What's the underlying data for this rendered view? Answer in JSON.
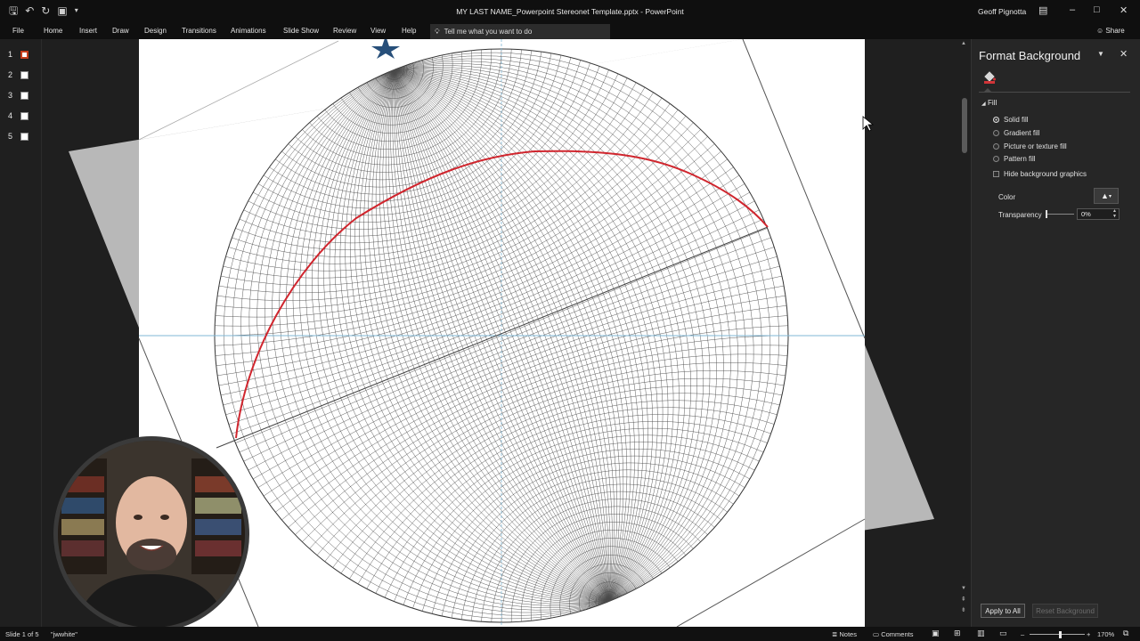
{
  "window": {
    "title": "MY LAST NAME_Powerpoint Stereonet Template.pptx  -  PowerPoint",
    "user": "Geoff Pignotta"
  },
  "ribbon": {
    "tabs": [
      "File",
      "Home",
      "Insert",
      "Draw",
      "Design",
      "Transitions",
      "Animations",
      "Slide Show",
      "Review",
      "View",
      "Help"
    ],
    "tell_me": "Tell me what you want to do",
    "share": "Share"
  },
  "thumbnails": {
    "numbers": [
      "1",
      "2",
      "3",
      "4",
      "5"
    ],
    "active_index": 0
  },
  "pane": {
    "title": "Format Background",
    "section": "Fill",
    "options": [
      "Solid fill",
      "Gradient fill",
      "Picture or texture fill",
      "Pattern fill"
    ],
    "selected_option": "Solid fill",
    "hide_graphics": "Hide background graphics",
    "color_label": "Color",
    "transparency_label": "Transparency",
    "transparency_value": "0%",
    "apply_all": "Apply to All",
    "reset": "Reset Background"
  },
  "status": {
    "slide": "Slide 1 of 5",
    "theme": "\"jwwhite\"",
    "notes": "Notes",
    "comments": "Comments",
    "zoom": "170%"
  },
  "icons": {
    "save": "save-icon",
    "undo": "undo-icon",
    "redo": "redo-icon",
    "paint_bucket": "paint-bucket-icon",
    "lightbulb": "lightbulb-icon"
  },
  "colors": {
    "great_circle": "#d0262e",
    "net_lines": "#4a4a4a",
    "axis_lines": "#7fb7d6",
    "star": "#274f7a",
    "active_thumb": "#c43e1c"
  }
}
